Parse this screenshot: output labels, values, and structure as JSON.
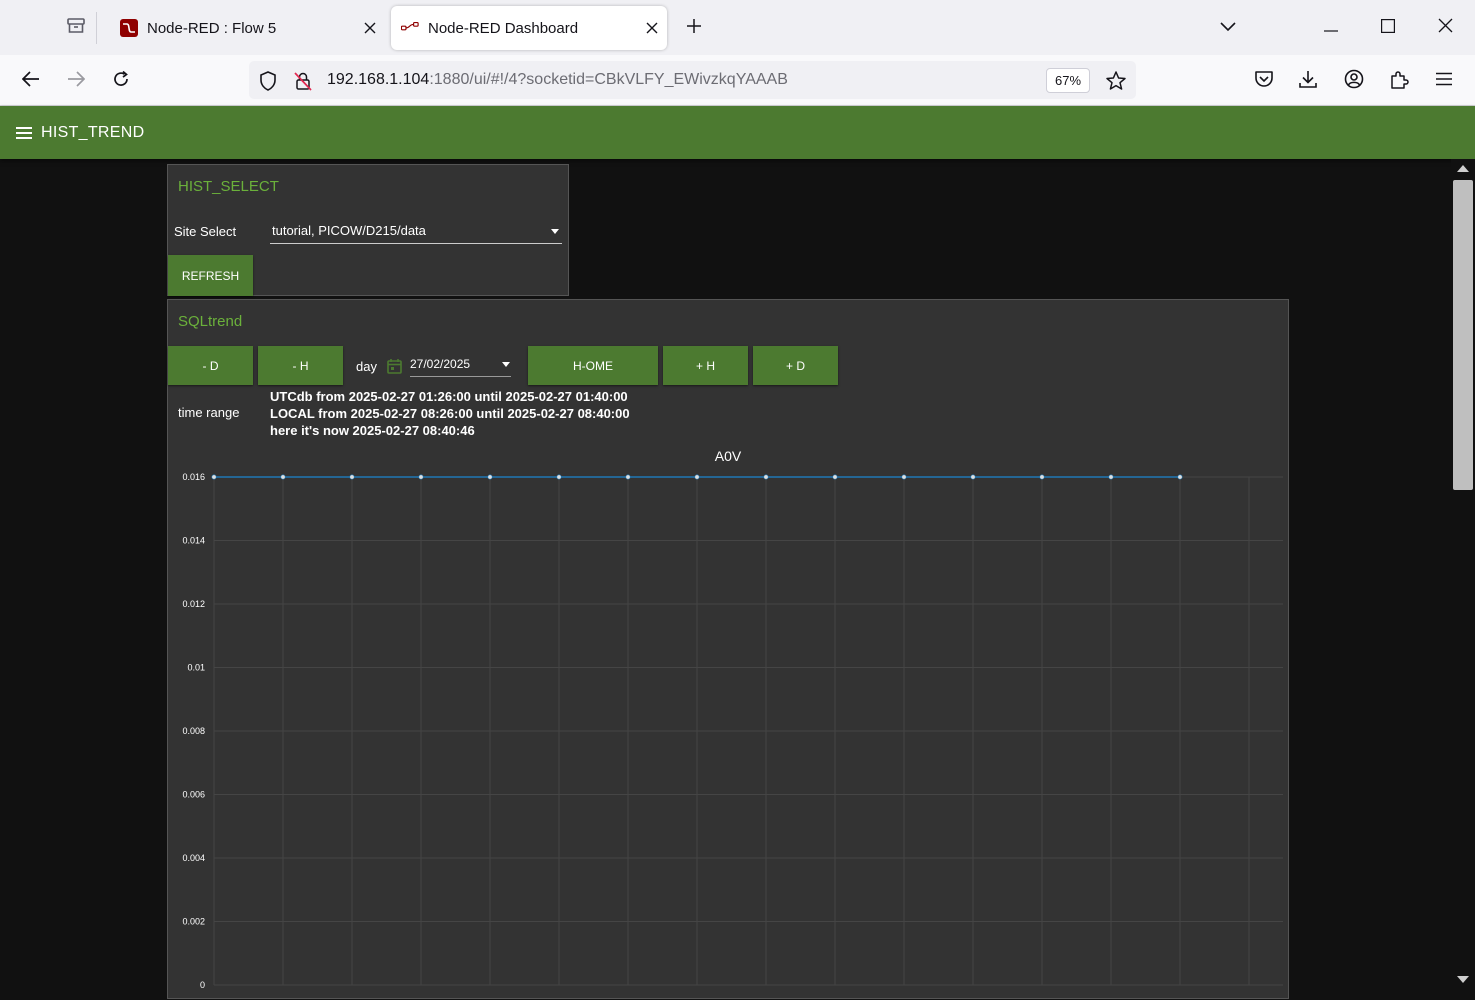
{
  "browser": {
    "tabs": [
      {
        "title": "Node-RED : Flow 5",
        "active": false
      },
      {
        "title": "Node-RED Dashboard",
        "active": true
      }
    ],
    "url_host": "192.168.1.104",
    "url_rest": ":1880/ui/#!/4?socketid=CBkVLFY_EWivzkqYAAAB",
    "zoom": "67%"
  },
  "dashboard": {
    "title": "HIST_TREND",
    "accent": "#4c7a30"
  },
  "hist_select": {
    "title": "HIST_SELECT",
    "site_label": "Site Select",
    "site_value": "tutorial, PICOW/D215/data",
    "refresh_label": "REFRESH"
  },
  "sqltrend": {
    "title": "SQLtrend",
    "buttons": {
      "minus_d": "- D",
      "minus_h": "- H",
      "home": "H-OME",
      "plus_h": "+ H",
      "plus_d": "+ D"
    },
    "day_label": "day",
    "date_value": "27/02/2025",
    "time_range_label": "time range",
    "utc_line": "UTCdb from 2025-02-27 01:26:00 until 2025-02-27 01:40:00",
    "local_line": "LOCAL from 2025-02-27 08:26:00 until 2025-02-27 08:40:00",
    "now_line": "here it's now 2025-02-27 08:40:46"
  },
  "chart_data": {
    "type": "line",
    "title": "A0V",
    "xlabel": "",
    "ylabel": "",
    "ylim": [
      0,
      0.016
    ],
    "yticks": [
      "0",
      "0.002",
      "0.004",
      "0.006",
      "0.008",
      "0.01",
      "0.012",
      "0.014",
      "0.016"
    ],
    "grid": true,
    "series": [
      {
        "color": "#1f77b4",
        "x": [
          0,
          1,
          2,
          3,
          4,
          5,
          6,
          7,
          8,
          9,
          10,
          11,
          12,
          13,
          14
        ],
        "values": [
          0.016,
          0.016,
          0.016,
          0.016,
          0.016,
          0.016,
          0.016,
          0.016,
          0.016,
          0.016,
          0.016,
          0.016,
          0.016,
          0.016,
          0.016
        ]
      }
    ]
  }
}
